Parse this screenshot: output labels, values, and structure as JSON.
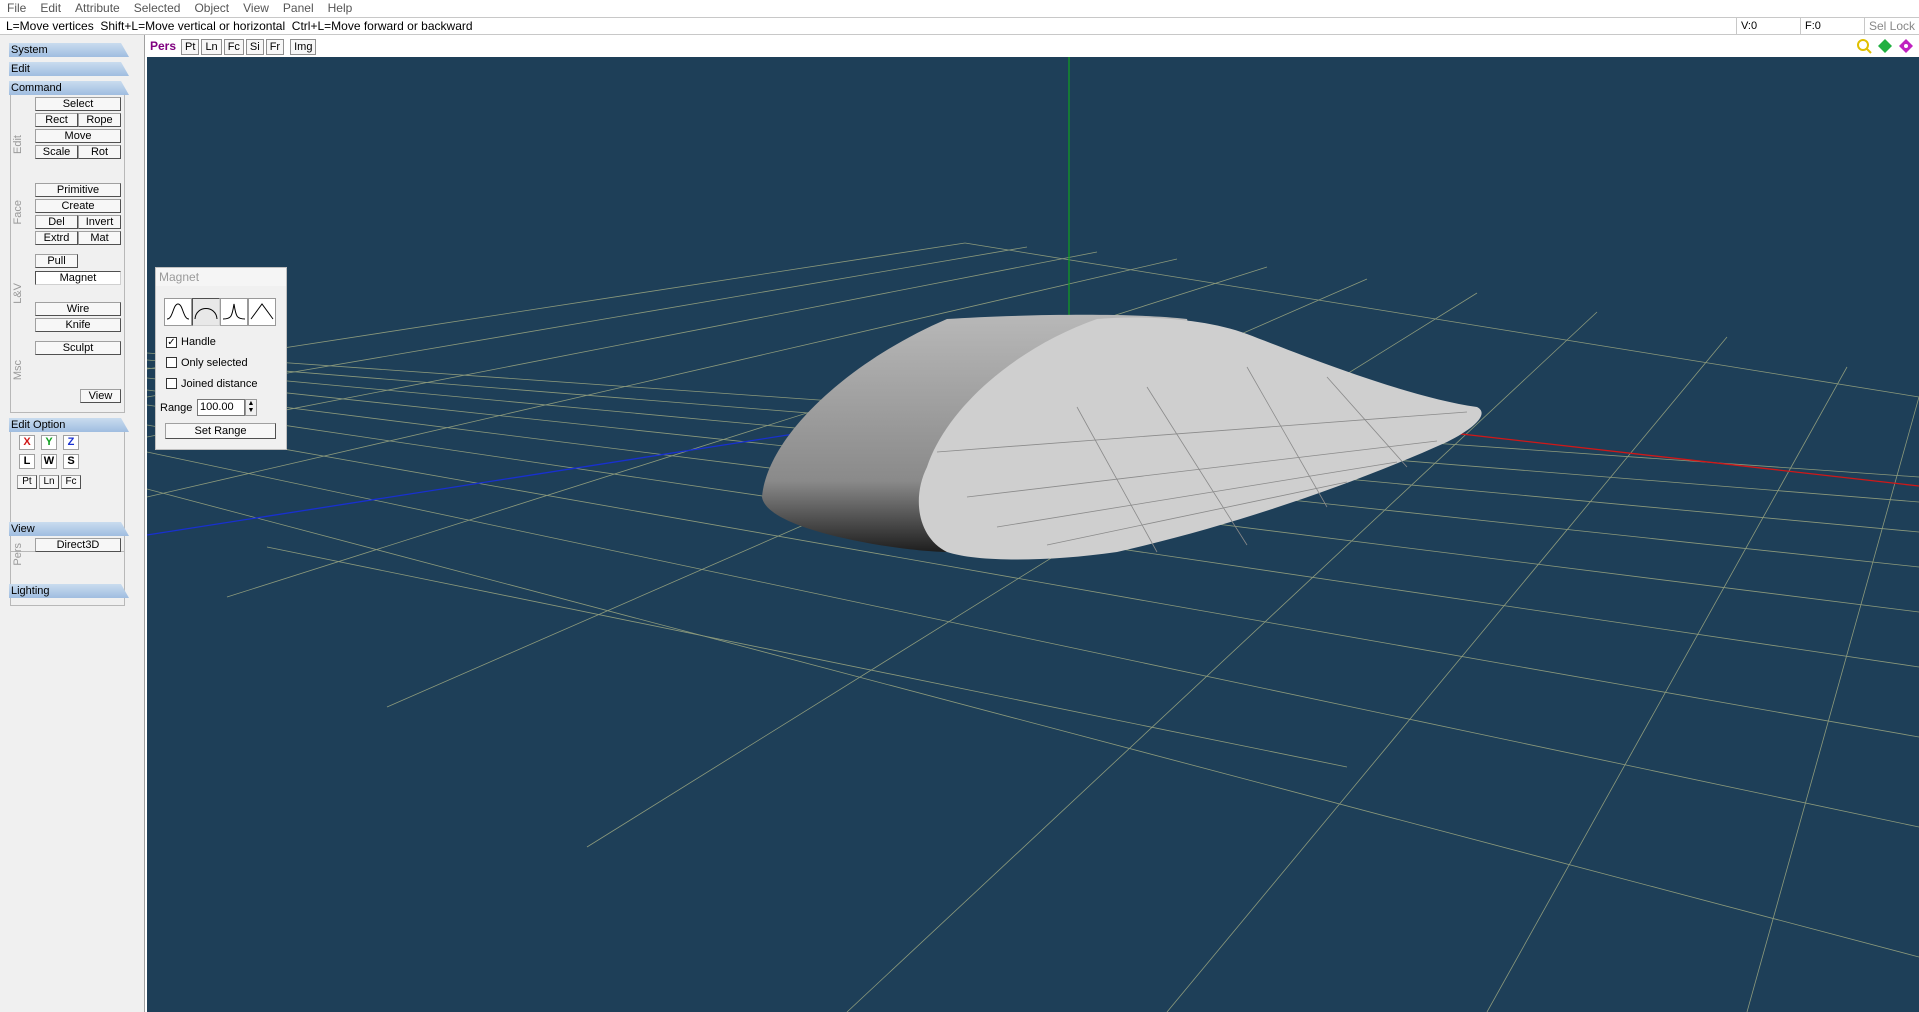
{
  "menu": [
    "File",
    "Edit",
    "Attribute",
    "Selected",
    "Object",
    "View",
    "Panel",
    "Help"
  ],
  "status": {
    "hint": "L=Move vertices  Shift+L=Move vertical or horizontal  Ctrl+L=Move forward or backward",
    "vertex": "V:0",
    "face": "F:0",
    "sel_lock": "Sel Lock"
  },
  "panel": {
    "system": "System",
    "edit": "Edit",
    "command": "Command",
    "edit_group": "Edit",
    "select": "Select",
    "rect": "Rect",
    "rope": "Rope",
    "move": "Move",
    "scale": "Scale",
    "rot": "Rot",
    "face_group": "Face",
    "primitive": "Primitive",
    "create": "Create",
    "del": "Del",
    "invert": "Invert",
    "extrd": "Extrd",
    "mat": "Mat",
    "lv_group": "L&V",
    "pull": "Pull",
    "magnet": "Magnet",
    "wire": "Wire",
    "knife": "Knife",
    "msc_group": "Msc",
    "sculpt": "Sculpt",
    "view_btn": "View",
    "edit_option": "Edit Option",
    "x": "X",
    "y": "Y",
    "z": "Z",
    "l": "L",
    "w": "W",
    "s": "S",
    "pt": "Pt",
    "ln": "Ln",
    "fc": "Fc",
    "view": "View",
    "pers_group": "Pers",
    "direct3d": "Direct3D",
    "lighting": "Lighting"
  },
  "viewtabs": [
    "Pers",
    "Pt",
    "Ln",
    "Fc",
    "Si",
    "Fr",
    "Img"
  ],
  "magnet_dialog": {
    "title": "Magnet",
    "handle": "Handle",
    "handle_checked": true,
    "only_selected": "Only selected",
    "joined_distance": "Joined distance",
    "range_label": "Range",
    "range_value": "100.00",
    "set_range": "Set Range"
  },
  "colors": {
    "viewport_bg": "#1e3f58",
    "axis_x": "#d01818",
    "axis_y": "#10a020",
    "axis_z": "#1830d0",
    "pers_tab": "#800080"
  }
}
